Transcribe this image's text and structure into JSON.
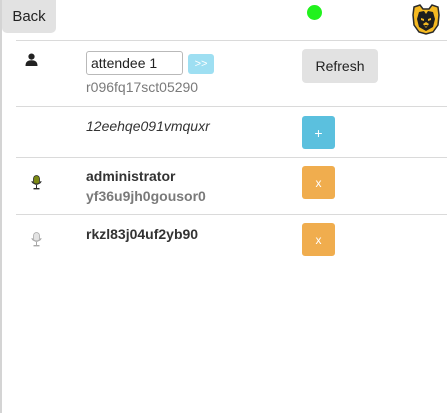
{
  "header": {
    "back_label": "Back",
    "status_color": "#21f21d",
    "logo_icon": "bear-head-logo"
  },
  "self_row": {
    "icon": "person-icon",
    "name_value": "attendee 1",
    "go_label": ">>",
    "id": "r096fq17sct05290",
    "refresh_label": "Refresh"
  },
  "invite_row": {
    "id": "12eehqe091vmquxr",
    "add_label": "+"
  },
  "participants": [
    {
      "name": "administrator",
      "id": "yf36u9jh0gousor0",
      "mic_icon": "microphone-active-icon",
      "remove_label": "x"
    },
    {
      "name": "rkzl83j04uf2yb90",
      "mic_icon": "microphone-muted-icon",
      "remove_label": "x"
    }
  ],
  "colors": {
    "accent_blue": "#5bc0de",
    "accent_orange": "#f0ad4e",
    "light_blue": "#9edff2",
    "neutral_button": "#e2e2e2"
  }
}
